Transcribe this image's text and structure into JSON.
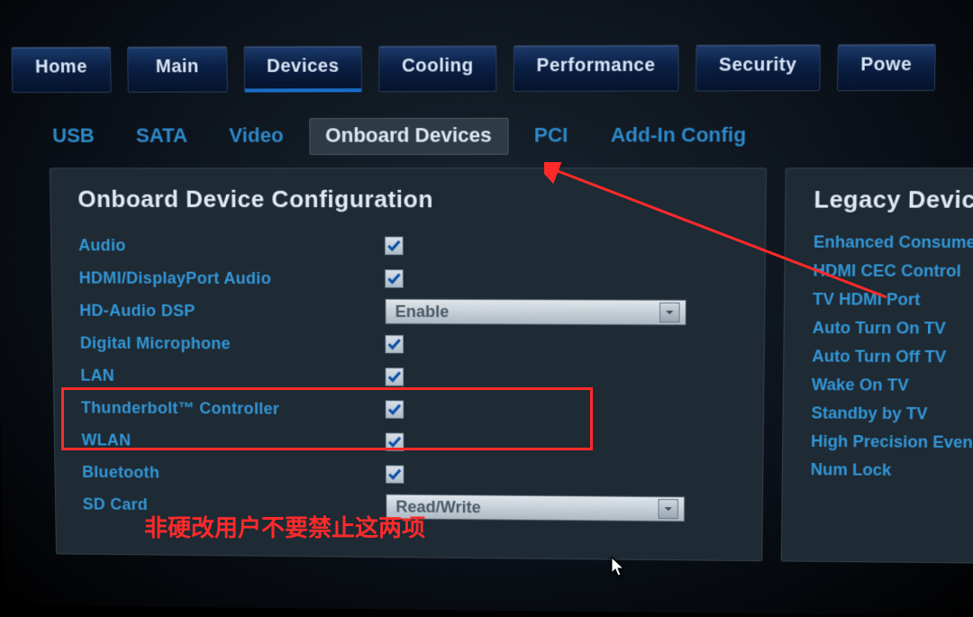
{
  "main_tabs": [
    {
      "label": "Home"
    },
    {
      "label": "Main"
    },
    {
      "label": "Devices"
    },
    {
      "label": "Cooling"
    },
    {
      "label": "Performance"
    },
    {
      "label": "Security"
    },
    {
      "label": "Powe"
    }
  ],
  "main_active_index": 2,
  "sub_tabs": [
    {
      "label": "USB"
    },
    {
      "label": "SATA"
    },
    {
      "label": "Video"
    },
    {
      "label": "Onboard Devices"
    },
    {
      "label": "PCI"
    },
    {
      "label": "Add-In Config"
    }
  ],
  "sub_active_index": 3,
  "panel_title": "Onboard Device Configuration",
  "config_rows": [
    {
      "label": "Audio",
      "control": "check",
      "checked": true
    },
    {
      "label": "HDMI/DisplayPort Audio",
      "control": "check",
      "checked": true
    },
    {
      "label": "HD-Audio DSP",
      "control": "select",
      "value": "Enable"
    },
    {
      "label": "Digital Microphone",
      "control": "check",
      "checked": true
    },
    {
      "label": "LAN",
      "control": "check",
      "checked": true
    },
    {
      "label": "Thunderbolt™ Controller",
      "control": "check",
      "checked": true
    },
    {
      "label": "WLAN",
      "control": "check",
      "checked": true
    },
    {
      "label": "Bluetooth",
      "control": "check",
      "checked": true
    },
    {
      "label": "SD Card",
      "control": "select",
      "value": "Read/Write"
    }
  ],
  "side_panel": {
    "title": "Legacy Devic",
    "items": [
      "Enhanced Consumer",
      "HDMI CEC Control",
      "TV HDMI Port",
      "Auto Turn On TV",
      "Auto Turn Off TV",
      "Wake On TV",
      "Standby by TV",
      "High Precision Even",
      "Num Lock"
    ]
  },
  "annotation": {
    "text": "非硬改用户不要禁止这两项"
  }
}
